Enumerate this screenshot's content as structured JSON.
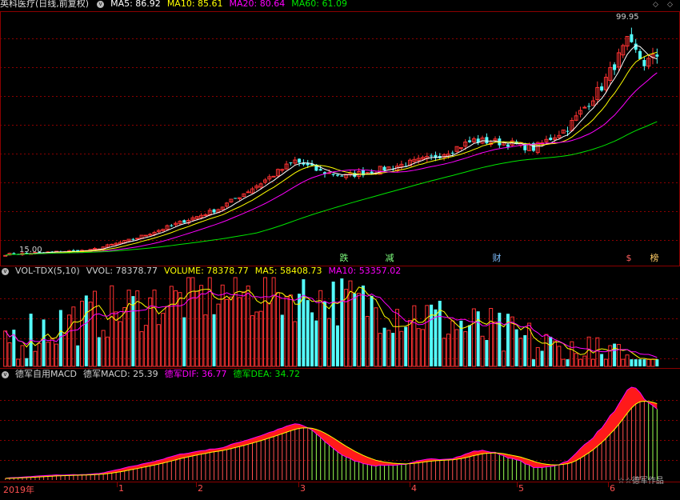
{
  "panel_main": {
    "stock_name": "英科医疗",
    "period": "(日线,前复权)",
    "ma5": "MA5: 86.92",
    "ma10": "MA10: 85.61",
    "ma20": "MA20: 80.64",
    "ma60": "MA60: 61.09",
    "high_label": "99.95",
    "low_label": "15.00"
  },
  "panel_vol": {
    "indicator": "VOL-TDX(5,10)",
    "vvol": "VVOL: 78378.77",
    "volume": "VOLUME: 78378.77",
    "ma5": "MA5: 58408.73",
    "ma10": "MA10: 53357.02"
  },
  "panel_macd": {
    "indicator": "德军自用MACD",
    "macd": "德军MACD: 25.39",
    "dif": "德军DIF: 36.77",
    "dea": "德军DEA: 34.72"
  },
  "markers": [
    {
      "text": "跌",
      "color": "#7fff7f"
    },
    {
      "text": "减",
      "color": "#7fff7f"
    },
    {
      "text": "财",
      "color": "#7fbfff"
    },
    {
      "text": "$",
      "color": "#ff6060"
    },
    {
      "text": "榜",
      "color": "#ffcc66"
    }
  ],
  "x_axis": {
    "year_label": "2019年",
    "months": [
      "1",
      "2",
      "3",
      "4",
      "5",
      "6"
    ]
  },
  "watermark": "☆☆德军作品",
  "colors": {
    "up": "#ff3232",
    "down": "#54fcfc",
    "ma5": "#ffffff",
    "ma10": "#ffff00",
    "ma20": "#ff00ff",
    "ma60": "#00e600",
    "grid": "#8b0000"
  },
  "chart_data": [
    {
      "type": "candlestick",
      "title": "英科医疗 (日线,前复权)",
      "x": "trading days, Dec 2018 - Jun 2019",
      "ylim": [
        15.0,
        99.95
      ],
      "price_anchors": [
        {
          "day": 0,
          "close": 15.0
        },
        {
          "day": 20,
          "close": 16.5
        },
        {
          "day": 30,
          "close": 20.5
        },
        {
          "day": 40,
          "close": 26.0
        },
        {
          "day": 50,
          "close": 31.5
        },
        {
          "day": 60,
          "close": 41.0
        },
        {
          "day": 68,
          "close": 49.0
        },
        {
          "day": 74,
          "close": 45.0
        },
        {
          "day": 80,
          "close": 43.5
        },
        {
          "day": 90,
          "close": 46.5
        },
        {
          "day": 100,
          "close": 50.0
        },
        {
          "day": 110,
          "close": 56.5
        },
        {
          "day": 118,
          "close": 55.5
        },
        {
          "day": 124,
          "close": 53.5
        },
        {
          "day": 132,
          "close": 61.0
        },
        {
          "day": 140,
          "close": 76.0
        },
        {
          "day": 146,
          "close": 92.0
        },
        {
          "day": 150,
          "close": 84.5
        },
        {
          "day": 153,
          "close": 86.92
        }
      ],
      "series": [
        {
          "name": "MA5",
          "last": 86.92
        },
        {
          "name": "MA10",
          "last": 85.61
        },
        {
          "name": "MA20",
          "last": 80.64
        },
        {
          "name": "MA60",
          "last": 61.09
        }
      ]
    },
    {
      "type": "bar",
      "title": "VOL-TDX(5,10)",
      "series": [
        {
          "name": "VOLUME",
          "last": 78378.77
        },
        {
          "name": "MA5",
          "last": 58408.73
        },
        {
          "name": "MA10",
          "last": 53357.02
        }
      ]
    },
    {
      "type": "bar",
      "title": "德军自用MACD",
      "series": [
        {
          "name": "德军MACD",
          "last": 25.39
        },
        {
          "name": "德军DIF",
          "last": 36.77
        },
        {
          "name": "德军DEA",
          "last": 34.72
        }
      ]
    }
  ]
}
